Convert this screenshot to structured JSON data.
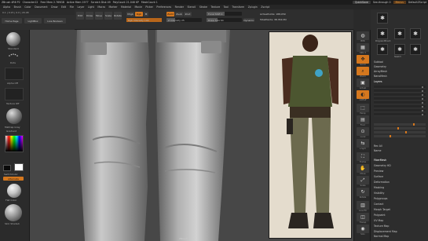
{
  "titlebar": {
    "app": "ZBrush 4R6 P2",
    "segments": [
      "Character12",
      "Free Mem 2.769GB",
      "Active Mem 1977",
      "Scratch Disk 49",
      "PolyCount 21.046 KP",
      "MeshCount 1"
    ],
    "quicksave": "QuickSave",
    "see_through": "See-through 0",
    "menus": "Menus",
    "default_script": "DefaultZScript"
  },
  "menubar": [
    "Alpha",
    "Brush",
    "Color",
    "Document",
    "Draw",
    "Edit",
    "File",
    "Layer",
    "Light",
    "Macro",
    "Marker",
    "Material",
    "Movie",
    "Picker",
    "Preferences",
    "Render",
    "Stencil",
    "Stroke",
    "Texture",
    "Tool",
    "Transform",
    "Zplugin",
    "Zscript"
  ],
  "status": "0.1 | 0.15 | 0.0 | 20.48",
  "toolrow": {
    "home": "Home Page",
    "lightbox": "LightBox",
    "live_boolean": "Live Boolean"
  },
  "shelf": {
    "edit": "Edit",
    "draw": "Draw",
    "move": "Move",
    "scale": "Scale",
    "rotate": "Rotate",
    "mrgb": "Mrgb",
    "rgb": "Rgb",
    "m": "M",
    "zadd": "Zadd",
    "zsub": "Zsub",
    "zcut": "Zcut",
    "focal_label": "Focal Shift 0",
    "draw_size_label": "Draw Size 64",
    "dynamic": "Dynamic",
    "rgb_intensity": "Rgb Intensity 100",
    "z_intensity": "Z Intensity 25",
    "active_points": "ActivePoints: 188,059",
    "total_points": "TotalPoints: 38.354 Mil"
  },
  "leftbar": {
    "standard": "Standard",
    "dots": "Dots",
    "alpha_off": "Alpha Off",
    "texture_off": "Texture Off",
    "matcap": "MatCap Gray",
    "gradient": "Gradient",
    "switch_color": "SwitchColor",
    "alternate": "Alternate",
    "flat_color": "Flat Color",
    "skin_shade": "Skin Shade4"
  },
  "rightnav": [
    "BPR",
    "SPix 3",
    "Scroll",
    "Zoom",
    "Actual",
    "AAHalf",
    "Persp",
    "Floor",
    "Local",
    "L.Sym",
    "Frame",
    "Move",
    "Scale",
    "Rotate",
    "Line Fill",
    "PolyF",
    "Transp",
    "Ghost",
    "Solo",
    "Xpose"
  ],
  "tray": {
    "brushes": [
      "PolypaintBrush",
      "Standard",
      "Move",
      "ClayBuildup",
      "DamStandard",
      "hPolish",
      "TrimDynamic",
      "Inflat",
      "Pinch",
      "Slash3"
    ],
    "top_items": [
      "Subtool",
      "Geometry",
      "ArrayMesh",
      "NanoMesh",
      "Layers"
    ],
    "layers_selected": "Layers",
    "layer_count": 8,
    "bottom_items": [
      "Rec All",
      "Name",
      "Bake All",
      "Import Layer",
      "Import MDD",
      "FiberMesh",
      "Geometry HD",
      "Preview",
      "Surface",
      "Deformation",
      "Masking",
      "Visibility",
      "Polygroups",
      "Contact",
      "Morph Target",
      "Polypaint",
      "UV Map",
      "Texture Map",
      "Displacement Map",
      "Normal Map",
      "Vector Displacement Map"
    ],
    "selected_bottom": "FiberMesh"
  },
  "viewport_bottom": "ZBrush",
  "colors": {
    "accent": "#d4771e",
    "panel": "#2d2d2d",
    "viewport": "#474747"
  }
}
